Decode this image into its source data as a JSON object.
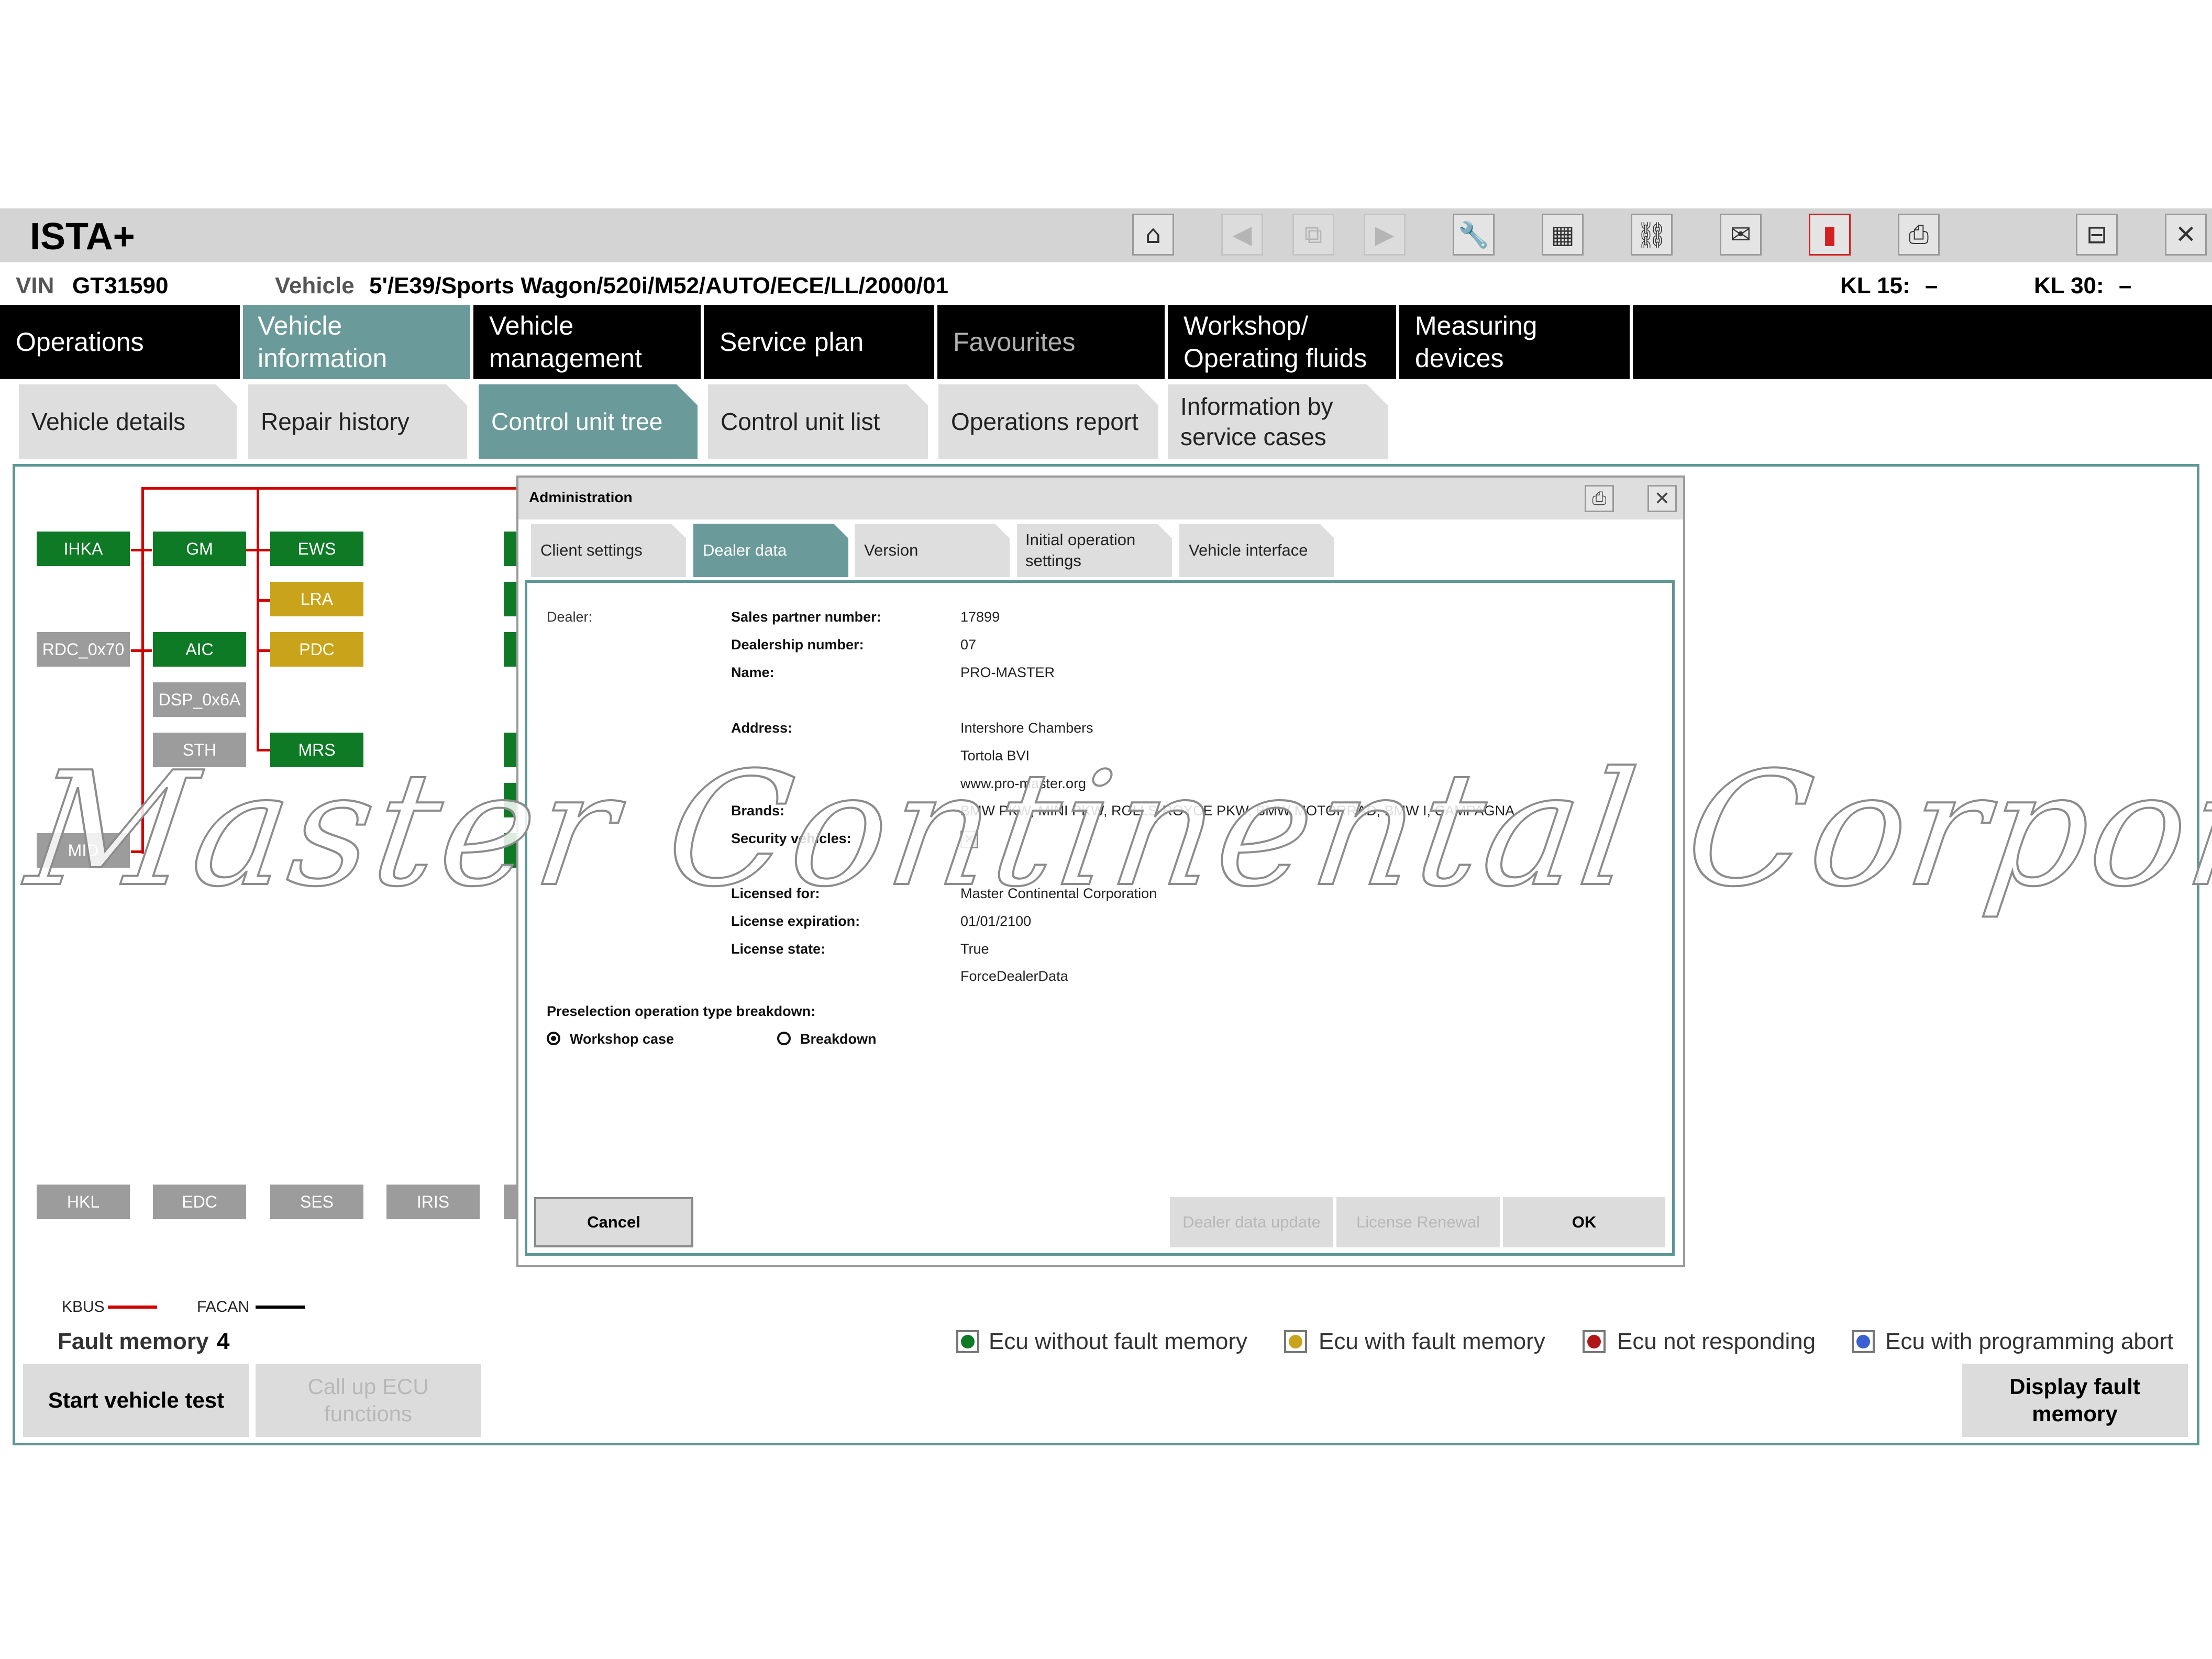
{
  "app": {
    "title": "ISTA+"
  },
  "toolbar": {
    "icons": [
      {
        "name": "home-icon",
        "glyph": "⌂",
        "state": "normal"
      },
      {
        "name": "back-icon",
        "glyph": "◀",
        "state": "disabled"
      },
      {
        "name": "copy-icon",
        "glyph": "⧉",
        "state": "disabled"
      },
      {
        "name": "forward-icon",
        "glyph": "▶",
        "state": "disabled"
      },
      {
        "name": "wrench-icon",
        "glyph": "🔧",
        "state": "normal"
      },
      {
        "name": "vehicle-info-icon",
        "glyph": "▦",
        "state": "normal"
      },
      {
        "name": "connection-icon",
        "glyph": "⛓",
        "state": "normal"
      },
      {
        "name": "mail-icon",
        "glyph": "✉",
        "state": "normal"
      },
      {
        "name": "battery-icon",
        "glyph": "▮",
        "state": "alert"
      },
      {
        "name": "print-icon",
        "glyph": "⎙",
        "state": "normal"
      },
      {
        "name": "minimize-icon",
        "glyph": "⊟",
        "state": "normal"
      },
      {
        "name": "close-icon",
        "glyph": "✕",
        "state": "normal"
      }
    ]
  },
  "vehicle": {
    "vin_label": "VIN",
    "vin": "GT31590",
    "vehicle_label": "Vehicle",
    "vehicle": "5'/E39/Sports Wagon/520i/M52/AUTO/ECE/LL/2000/01",
    "kl15_label": "KL 15:",
    "kl15": "–",
    "kl30_label": "KL 30:",
    "kl30": "–"
  },
  "main_nav": [
    {
      "label": "Operations",
      "state": "normal"
    },
    {
      "label": "Vehicle information",
      "state": "active"
    },
    {
      "label": "Vehicle management",
      "state": "normal"
    },
    {
      "label": "Service plan",
      "state": "normal"
    },
    {
      "label": "Favourites",
      "state": "dim"
    },
    {
      "label": "Workshop/ Operating fluids",
      "state": "normal"
    },
    {
      "label": "Measuring devices",
      "state": "normal"
    }
  ],
  "sub_tabs": [
    {
      "label": "Vehicle details",
      "state": "normal"
    },
    {
      "label": "Repair history",
      "state": "normal"
    },
    {
      "label": "Control unit tree",
      "state": "active"
    },
    {
      "label": "Control unit list",
      "state": "normal"
    },
    {
      "label": "Operations report",
      "state": "normal"
    },
    {
      "label": "Information by service cases",
      "state": "normal"
    }
  ],
  "ecus": [
    {
      "label": "IHKA",
      "status": "green"
    },
    {
      "label": "GM",
      "status": "green"
    },
    {
      "label": "EWS",
      "status": "green"
    },
    {
      "label": "LRA",
      "status": "yellow"
    },
    {
      "label": "RDC_0x70",
      "status": "grey"
    },
    {
      "label": "AIC",
      "status": "green"
    },
    {
      "label": "PDC",
      "status": "yellow"
    },
    {
      "label": "DSP_0x6A",
      "status": "grey"
    },
    {
      "label": "STH",
      "status": "grey"
    },
    {
      "label": "MRS",
      "status": "green"
    },
    {
      "label": "MID",
      "status": "grey"
    },
    {
      "label": "HKL",
      "status": "grey"
    },
    {
      "label": "EDC",
      "status": "grey"
    },
    {
      "label": "SES",
      "status": "grey"
    },
    {
      "label": "IRIS",
      "status": "grey"
    }
  ],
  "bus_legend": [
    {
      "label": "KBUS",
      "color": "#d00000"
    },
    {
      "label": "FACAN",
      "color": "#000000"
    }
  ],
  "fault_memory": {
    "label": "Fault memory",
    "count": "4"
  },
  "status_legend": [
    {
      "label": "Ecu without fault memory",
      "color": "#0e7a26"
    },
    {
      "label": "Ecu with fault memory",
      "color": "#c9a41a"
    },
    {
      "label": "Ecu not responding",
      "color": "#b01818"
    },
    {
      "label": "Ecu with programming abort",
      "color": "#3a5fd0"
    }
  ],
  "bottom_buttons": {
    "start_test": "Start vehicle test",
    "call_ecu": "Call up ECU functions",
    "display_fault": "Display fault memory"
  },
  "dialog": {
    "title": "Administration",
    "tabs": [
      {
        "label": "Client settings",
        "state": "normal"
      },
      {
        "label": "Dealer data",
        "state": "active"
      },
      {
        "label": "Version",
        "state": "normal"
      },
      {
        "label": "Initial operation settings",
        "state": "normal"
      },
      {
        "label": "Vehicle interface",
        "state": "normal"
      }
    ],
    "dealer_label": "Dealer:",
    "fields": {
      "sales_partner_label": "Sales partner number:",
      "sales_partner": "17899",
      "dealership_label": "Dealership number:",
      "dealership": "07",
      "name_label": "Name:",
      "name": "PRO-MASTER",
      "address_label": "Address:",
      "address_1": "Intershore Chambers",
      "address_2": "Tortola BVI",
      "address_3": "www.pro-master.org",
      "brands_label": "Brands:",
      "brands": "BMW PKW, MINI PKW, ROLLS-ROYCE PKW, BMW MOTORRAD, BMW I, CAMPAGNA",
      "security_label": "Security vehicles:",
      "security_checked": true,
      "licensed_label": "Licensed for:",
      "licensed": "Master Continental Corporation",
      "expiration_label": "License expiration:",
      "expiration": "01/01/2100",
      "state_label": "License state:",
      "state": "True",
      "state_extra": "ForceDealerData"
    },
    "preselection": {
      "label": "Preselection operation type breakdown:",
      "option_workshop": "Workshop case",
      "option_breakdown": "Breakdown",
      "selected": "Workshop case"
    },
    "buttons": {
      "cancel": "Cancel",
      "dealer_update": "Dealer data update",
      "license_renewal": "License Renewal",
      "ok": "OK"
    }
  },
  "watermark": {
    "text": "Master Continental Corporation ®"
  }
}
